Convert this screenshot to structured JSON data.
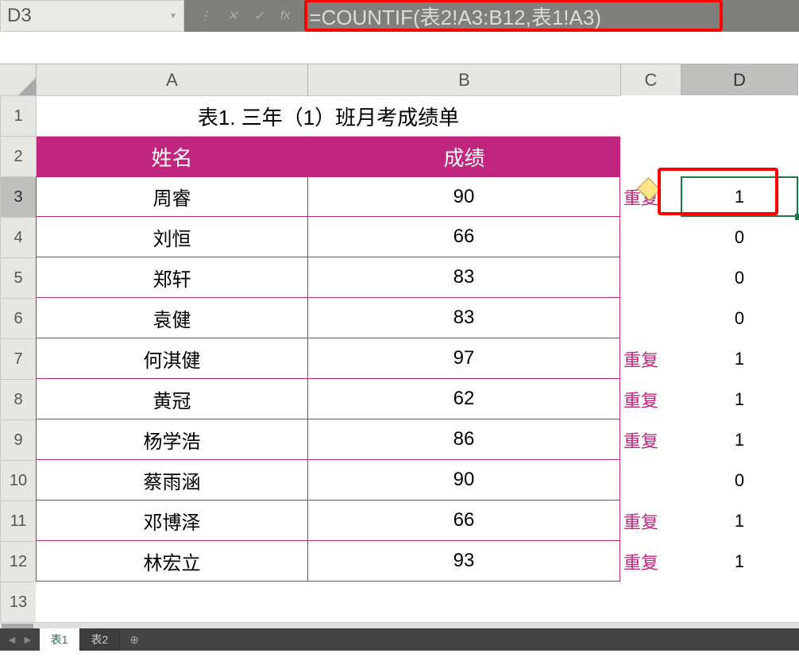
{
  "name_box": "D3",
  "formula": "=COUNTIF(表2!A3:B12,表1!A3)",
  "columns": {
    "a": "A",
    "b": "B",
    "c": "C",
    "d": "D"
  },
  "title": "表1. 三年（1）班月考成绩单",
  "headers": {
    "name": "姓名",
    "score": "成绩"
  },
  "rows": [
    {
      "n": "3",
      "name": "周睿",
      "score": "90",
      "c": "重复",
      "d": "1"
    },
    {
      "n": "4",
      "name": "刘恒",
      "score": "66",
      "c": "",
      "d": "0"
    },
    {
      "n": "5",
      "name": "郑轩",
      "score": "83",
      "c": "",
      "d": "0"
    },
    {
      "n": "6",
      "name": "袁健",
      "score": "83",
      "c": "",
      "d": "0"
    },
    {
      "n": "7",
      "name": "何淇健",
      "score": "97",
      "c": "重复",
      "d": "1"
    },
    {
      "n": "8",
      "name": "黄冠",
      "score": "62",
      "c": "重复",
      "d": "1"
    },
    {
      "n": "9",
      "name": "杨学浩",
      "score": "86",
      "c": "重复",
      "d": "1"
    },
    {
      "n": "10",
      "name": "蔡雨涵",
      "score": "90",
      "c": "",
      "d": "0"
    },
    {
      "n": "11",
      "name": "邓博泽",
      "score": "66",
      "c": "重复",
      "d": "1"
    },
    {
      "n": "12",
      "name": "林宏立",
      "score": "93",
      "c": "重复",
      "d": "1"
    }
  ],
  "rowlabels": {
    "r1": "1",
    "r2": "2",
    "r13": "13"
  },
  "tabs": {
    "active": "表1",
    "other": "表2",
    "add": "⊕"
  },
  "nav": {
    "first": "|◄",
    "prev": "◄",
    "next": "►"
  },
  "icons": {
    "vbar": "⋮",
    "x": "✕",
    "check": "✓",
    "fx": "fx",
    "dd": "▼"
  }
}
